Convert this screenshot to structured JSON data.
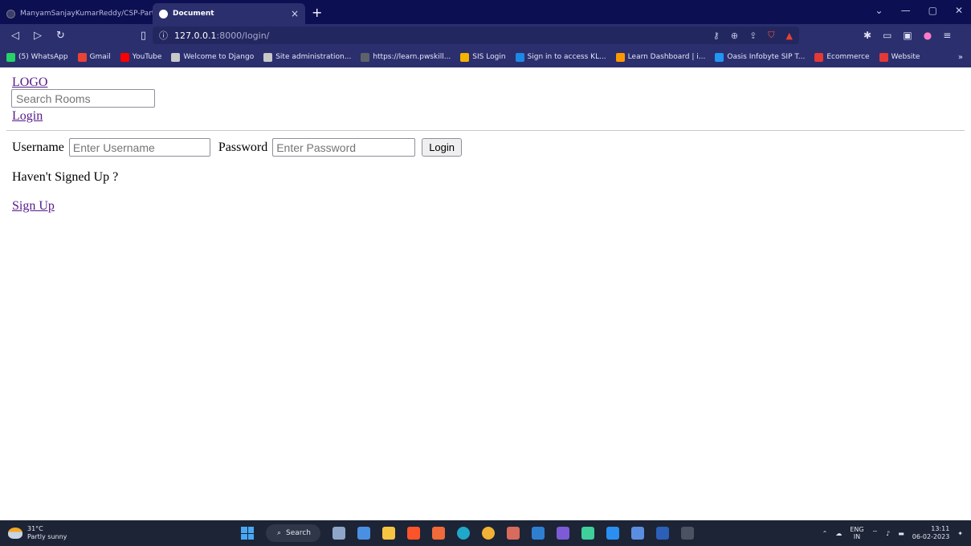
{
  "browser": {
    "tabs": [
      {
        "title": "ManyamSanjayKumarReddy/CSP-Part",
        "active": false
      },
      {
        "title": "Document",
        "active": true
      }
    ],
    "new_tab": "+",
    "close_tab": "×",
    "address": {
      "host": "127.0.0.1",
      "path": ":8000/login/"
    },
    "bookmarks": [
      {
        "label": "(5) WhatsApp",
        "color": "#25d366"
      },
      {
        "label": "Gmail",
        "color": "#ea4335"
      },
      {
        "label": "YouTube",
        "color": "#ff0000"
      },
      {
        "label": "Welcome to Django",
        "color": "#c8c8c8"
      },
      {
        "label": "Site administration...",
        "color": "#c8c8c8"
      },
      {
        "label": "https://learn.pwskill...",
        "color": "#5f6368"
      },
      {
        "label": "SIS Login",
        "color": "#f4b400"
      },
      {
        "label": "Sign in to access KL...",
        "color": "#1e88e5"
      },
      {
        "label": "Learn Dashboard | i...",
        "color": "#ff9800"
      },
      {
        "label": "Oasis Infobyte SIP T...",
        "color": "#2196f3"
      },
      {
        "label": "Ecommerce",
        "color": "#e53935"
      },
      {
        "label": "Website",
        "color": "#e53935"
      }
    ],
    "bookmarks_more": "»"
  },
  "page": {
    "logo": "LOGO",
    "search_placeholder": "Search Rooms",
    "nav_login": "Login",
    "form": {
      "username_label": "Username",
      "username_placeholder": "Enter Username",
      "password_label": "Password",
      "password_placeholder": "Enter Password",
      "submit_label": "Login"
    },
    "prompt": "Haven't Signed Up ?",
    "signup_link": "Sign Up"
  },
  "taskbar": {
    "weather_temp": "31°C",
    "weather_desc": "Partly sunny",
    "search_label": "Search",
    "lang_top": "ENG",
    "lang_bottom": "IN",
    "time": "13:11",
    "date": "06-02-2023"
  }
}
